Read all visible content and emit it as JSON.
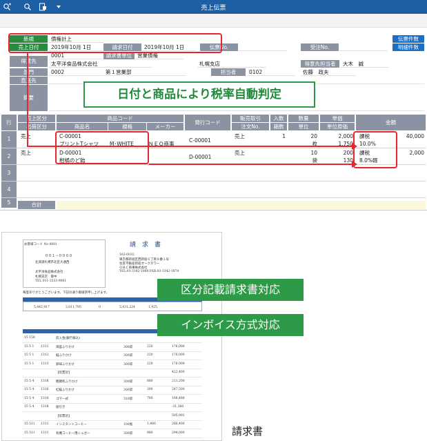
{
  "window": {
    "title": "売上伝票"
  },
  "toolbar_icons": [
    "search-plus-icon",
    "search-icon",
    "document-icon",
    "dropdown-arrow-icon"
  ],
  "header": {
    "new_label": "新規",
    "new_value": "債権計上",
    "sales_date_label": "売上日付",
    "sales_date_value": "2019年10月 1日",
    "bill_date_label": "請求日付",
    "bill_date_value": "2019年10月 1日",
    "slip_no_label": "伝票No.",
    "order_no_label": "受注No.",
    "slip_count_button": "伝票件数",
    "detail_count_button": "明細件数",
    "customer_code": "0001",
    "billing_unit_label": "請求書単位",
    "billing_unit_value": "営業債権",
    "customer_label": "得意先",
    "customer_name": "太平洋食品株式会社",
    "branch_name": "札幌支店",
    "contact_label": "得意先担当者",
    "contact_name": "大木　誠",
    "dept_label": "部門",
    "dept_code": "0002",
    "dept_name": "第１営業部",
    "staff_label": "担当者",
    "staff_code": "0102",
    "staff_name": "佐藤　政夫",
    "delivery_label": "直送先",
    "memo_label": "摘要"
  },
  "banner_top": "日付と商品により税率自動判定",
  "grid": {
    "headers": {
      "row": "行",
      "sales_type": "売上区分",
      "ship_type": "出荷区分",
      "product_code": "商品コード",
      "product_name": "商品名",
      "spec": "規格",
      "maker": "メーカー",
      "issue_code": "発行コード",
      "sales_deal": "販売取引",
      "order_no": "注文No.",
      "in_count": "入数",
      "box_count": "箱数",
      "quantity": "数量",
      "unit": "単位",
      "price": "単価",
      "unit_cost": "単位原価",
      "amount": "金額"
    },
    "rows": [
      {
        "no": "1",
        "sales_type": "売上",
        "code": "C-00001",
        "name": "プリントTシャツ",
        "spec": "M･WHITE",
        "maker": "ＮＥＯ商事",
        "issue": "C-00001",
        "deal": "売上",
        "in": "1",
        "qty": "20",
        "unit": "枚",
        "price": "2,000",
        "cost": "1,750",
        "tax": "課税",
        "rate": "10.0%",
        "amount": "40,000"
      },
      {
        "no": "2",
        "sales_type": "売上",
        "code": "D-00001",
        "name": "柑橘のど飴",
        "spec": "",
        "maker": "",
        "issue": "D-00001",
        "deal": "売上",
        "in": "",
        "qty": "10",
        "unit": "袋",
        "price": "200",
        "cost": "130",
        "tax": "課税",
        "rate": "8.0%軽",
        "amount": "2,000"
      },
      {
        "no": "3"
      },
      {
        "no": "4"
      },
      {
        "no": "5"
      }
    ],
    "total_label": "合計"
  },
  "document": {
    "title": "請　求　書",
    "customer_code": "お客様コード No 0001",
    "postal": "００１－００００",
    "address": "北海道札幌市北区大通西",
    "company": "太平洋食品株式会社",
    "company2": "札幌支店　御中",
    "tel": "TEL 011-3333-9001",
    "sender_post": "163-0032",
    "sender_addr": "東京都新宿区西新宿６丁目８番１号",
    "sender_bldg": "住友不動産新宿オークタワー",
    "sender_name": "ＯＢＣ商事株式会社",
    "sender_tel": "TEL:03-3342-1880  FAX:03-3342-1874",
    "greeting": "毎度ありがとうございます。下記の通り御請求申し上げます。",
    "summary_vals": [
      "5,442,917",
      "2,011,795",
      "0",
      "5,431,224",
      "1,925,"
    ],
    "lines": [
      {
        "date": "15 158",
        "code": "",
        "name": "前入金(銀行振込)",
        "qty": "",
        "price": "",
        "amount": ""
      },
      {
        "date": "15 5 1",
        "code": "1311",
        "name": "海苔ふりかけ",
        "qty": "300袋",
        "price": "220",
        "amount": "176,000"
      },
      {
        "date": "15 5 1",
        "code": "1312",
        "name": "鮭ふりかけ",
        "qty": "300袋",
        "price": "220",
        "amount": "176,000"
      },
      {
        "date": "15 5 1",
        "code": "1313",
        "name": "卵味ふりかけ",
        "qty": "300袋",
        "price": "220",
        "amount": "176,000"
      },
      {
        "date": "",
        "code": "",
        "name": "【伝票計】",
        "qty": "",
        "price": "",
        "amount": "422,400"
      },
      {
        "date": "15 5 4",
        "code": "1316",
        "name": "鰹節煎ふりかけ",
        "qty": "300袋",
        "price": "880",
        "amount": "211,200"
      },
      {
        "date": "15 5 4",
        "code": "1316",
        "name": "紅鮭ふりかけ",
        "qty": "300袋",
        "price": "300",
        "amount": "247,500"
      },
      {
        "date": "15 5 4",
        "code": "1316",
        "name": "ゴマ一式",
        "qty": "310袋",
        "price": "780",
        "amount": "168,480"
      },
      {
        "date": "15 5 4",
        "code": "1318",
        "name": "値引き",
        "qty": "",
        "price": "",
        "amount": "-31,360"
      },
      {
        "date": "",
        "code": "",
        "name": "【伝票計】",
        "qty": "",
        "price": "",
        "amount": "595,992"
      },
      {
        "date": "15 511",
        "code": "1311",
        "name": "インスタントコーヒー",
        "qty": "100瓶",
        "price": "1,480",
        "amount": "266,400"
      },
      {
        "date": "15 511",
        "code": "1311",
        "name": "有機コーヒー用シュガー",
        "qty": "300袋",
        "price": "980",
        "amount": "294,000"
      }
    ]
  },
  "banner_doc1": "区分記載請求書対応",
  "banner_doc2": "インボイス方式対応",
  "caption": "請求書",
  "colors": {
    "title_bar": "#1d5fa5",
    "label_gray": "#8b93a3",
    "highlight_red": "#e8242f",
    "banner_green": "#2c9a46"
  }
}
